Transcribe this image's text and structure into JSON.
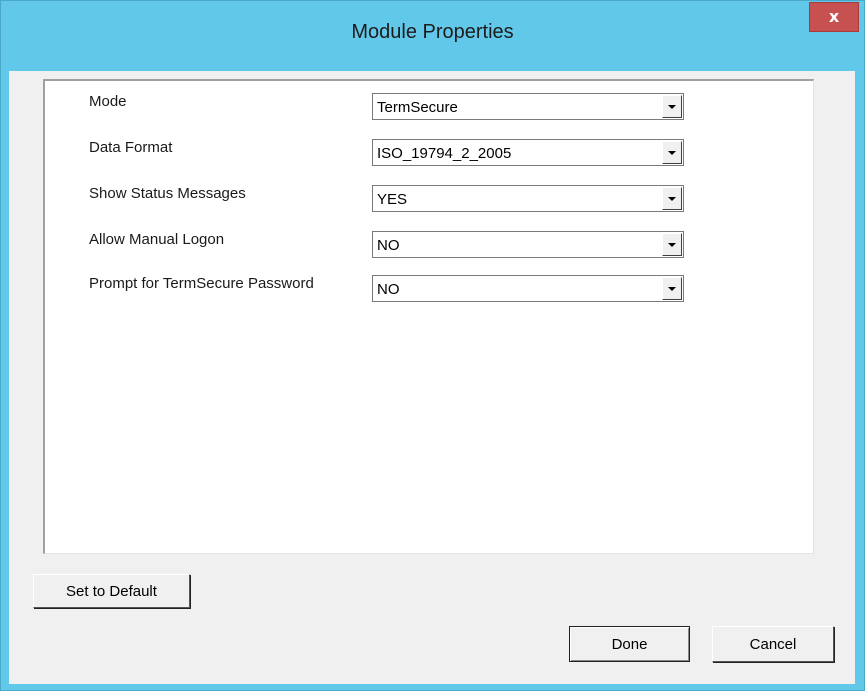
{
  "window": {
    "title": "Module Properties",
    "close_glyph": "x"
  },
  "properties": [
    {
      "label": "Mode",
      "value": "TermSecure"
    },
    {
      "label": "Data Format",
      "value": "ISO_19794_2_2005"
    },
    {
      "label": "Show Status Messages",
      "value": "YES"
    },
    {
      "label": "Allow Manual Logon",
      "value": "NO"
    },
    {
      "label": "Prompt for TermSecure Password",
      "value": "NO"
    }
  ],
  "buttons": {
    "set_default": "Set to Default",
    "done": "Done",
    "cancel": "Cancel"
  },
  "colors": {
    "titlebar": "#62c8ea",
    "close_button": "#c75050"
  },
  "icons": {
    "close": "close-icon",
    "dropdown": "chevron-down-icon"
  }
}
